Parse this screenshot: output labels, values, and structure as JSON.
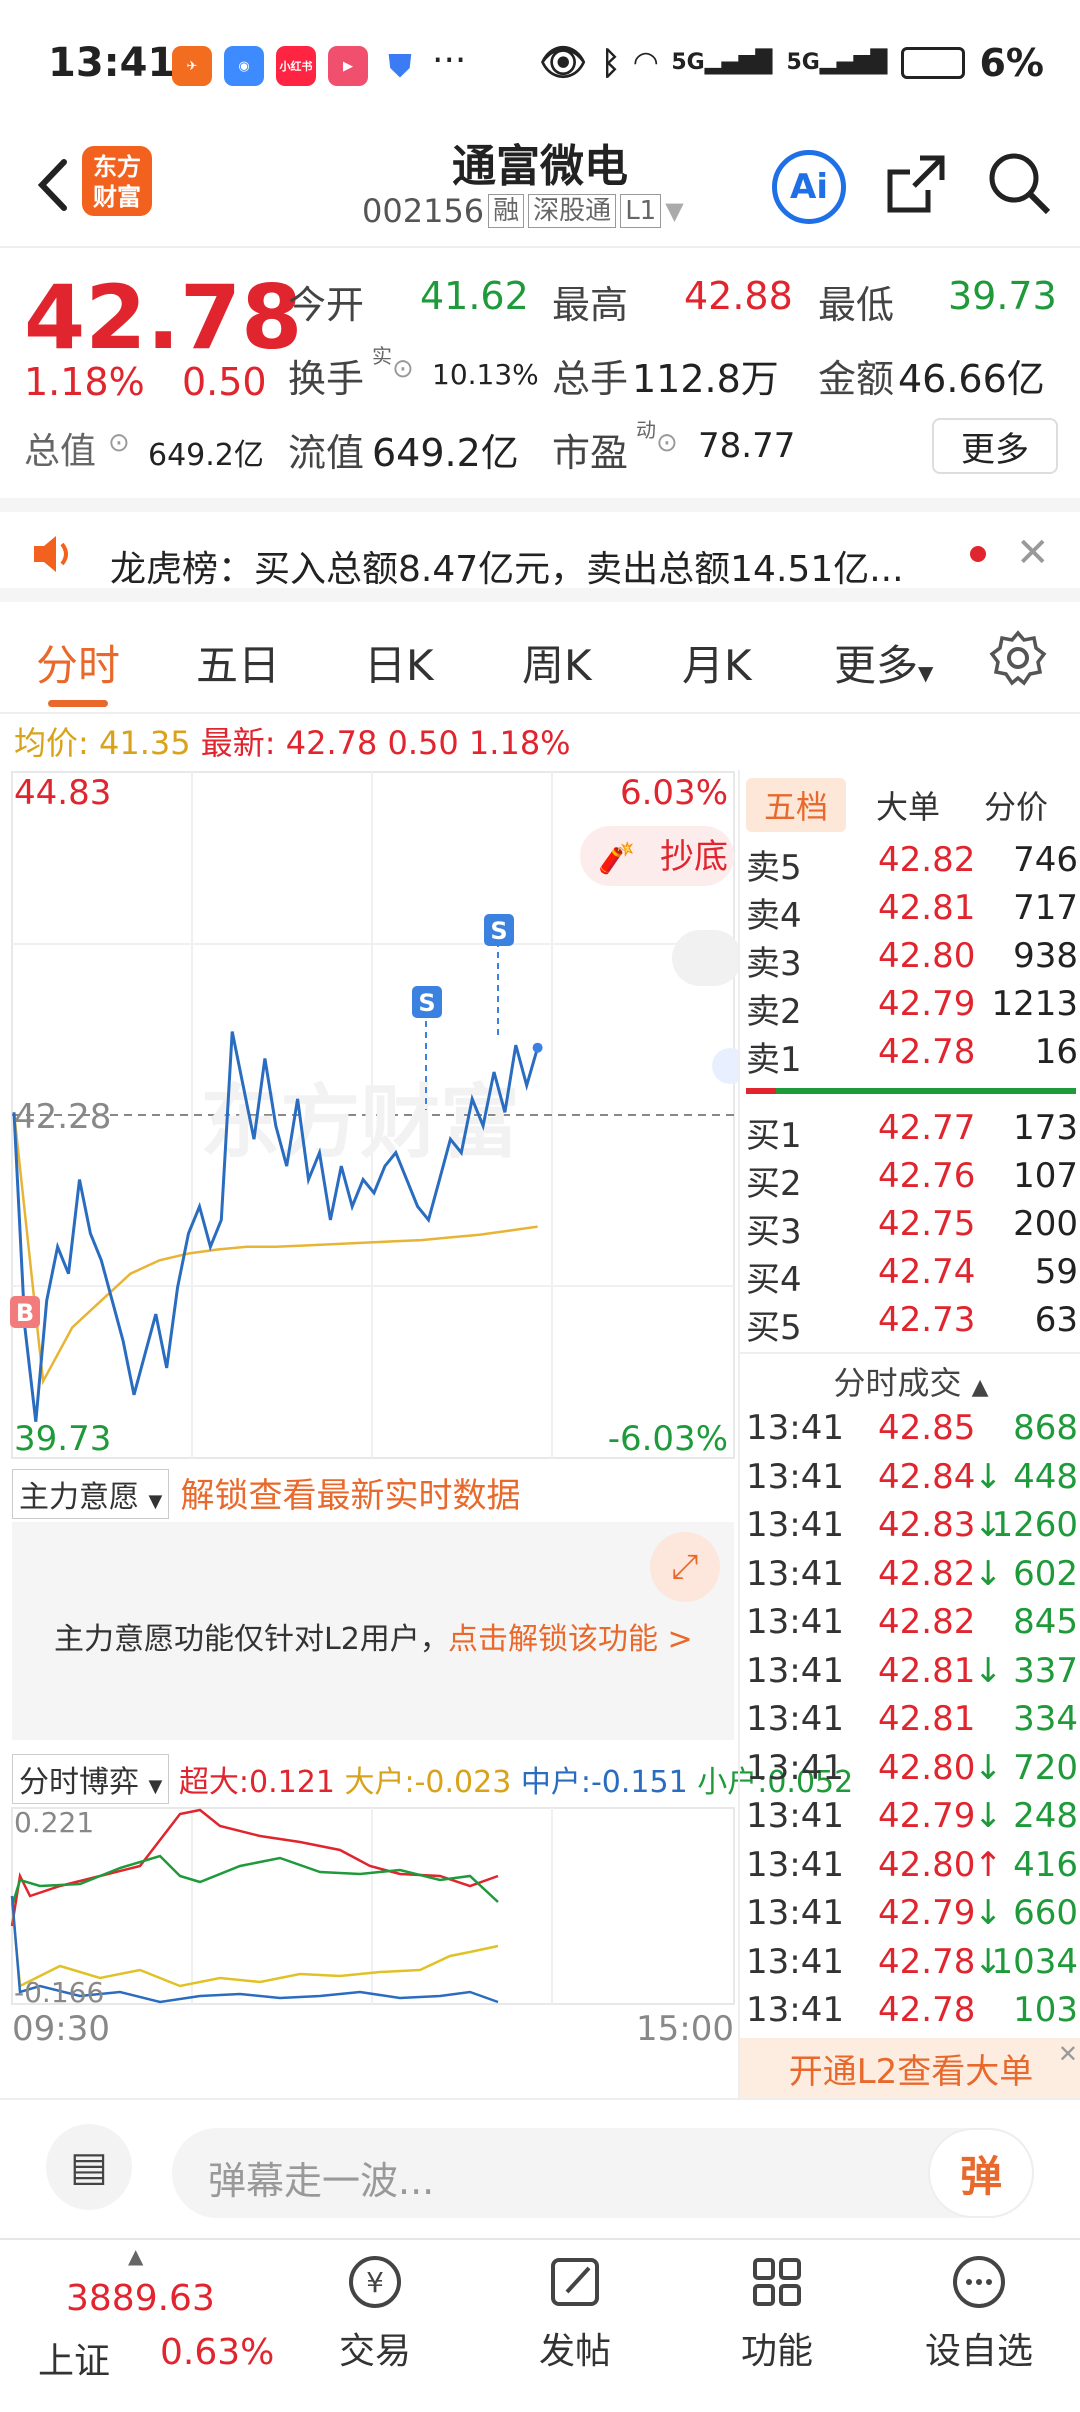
{
  "status_bar": {
    "time": "13:41",
    "battery": "6%",
    "network": "5G",
    "apps": [
      "小红书"
    ]
  },
  "header": {
    "title": "通富微电",
    "code": "002156",
    "tags": [
      "融",
      "深股通",
      "L1"
    ],
    "logo_text": "东方财富",
    "ai_label": "Ai"
  },
  "quote": {
    "price": "42.78",
    "change_pct": "1.18%",
    "change": "0.50",
    "open_label": "今开",
    "open": "41.62",
    "high_label": "最高",
    "high": "42.88",
    "low_label": "最低",
    "low": "39.73",
    "turnover_label": "换手",
    "turnover_sup": "实",
    "turnover": "10.13%",
    "volume_label": "总手",
    "volume": "112.8万",
    "amount_label": "金额",
    "amount": "46.66亿",
    "mktcap_label": "总值",
    "mktcap": "649.2亿",
    "float_label": "流值",
    "float": "649.2亿",
    "pe_label": "市盈",
    "pe_sup": "动",
    "pe": "78.77",
    "more_label": "更多"
  },
  "banner": {
    "text": "龙虎榜：买入总额8.47亿元，卖出总额14.51亿..."
  },
  "tabs": [
    "分时",
    "五日",
    "日K",
    "周K",
    "月K",
    "更多"
  ],
  "info_line": {
    "avg_label": "均价:",
    "avg": "41.35",
    "latest_label": "最新:",
    "latest": "42.78",
    "chg": "0.50",
    "pct": "1.18%"
  },
  "chart": {
    "y_max": "44.83",
    "y_mid": "42.28",
    "y_min": "39.73",
    "pct_max": "6.03%",
    "pct_min": "-6.03%",
    "watermark": "东方财富",
    "badge": "抄底",
    "b_marker": "B",
    "s_marker": "S"
  },
  "chart_data": {
    "type": "line",
    "title": "",
    "ylim": [
      39.73,
      44.83
    ],
    "series": [
      {
        "values": [
          42.3,
          40.7,
          40.0,
          40.9,
          41.3,
          41.1,
          41.8,
          41.4,
          41.2,
          40.9,
          40.6,
          40.2,
          40.5,
          40.8,
          40.4,
          41.0,
          41.4,
          41.6,
          41.3,
          41.5,
          42.9,
          42.5,
          42.1,
          42.7,
          42.2,
          41.9,
          42.4,
          41.8,
          42.0,
          41.5,
          41.9,
          41.6,
          41.8,
          41.7,
          41.9,
          42.0,
          41.8,
          41.6,
          41.5,
          41.8,
          42.1,
          42.0,
          42.4,
          42.2,
          42.6,
          42.3,
          42.8,
          42.5,
          42.78
        ]
      },
      {
        "values": [
          42.3,
          40.3,
          40.7,
          40.9,
          41.1,
          41.2,
          41.25,
          41.28,
          41.3,
          41.3,
          41.31,
          41.32,
          41.33,
          41.34,
          41.35,
          41.37,
          41.39,
          41.42,
          41.45
        ]
      }
    ]
  },
  "lower_panels": {
    "panel1_label": "主力意愿",
    "panel1_unlock": "解锁查看最新实时数据",
    "panel1_text": "主力意愿功能仅针对L2用户，",
    "panel1_link": "点击解锁该功能 >",
    "panel2_label": "分时博弈",
    "super_label": "超大:",
    "super": "0.121",
    "large_label": "大户:",
    "large": "-0.023",
    "mid_label": "中户:",
    "mid": "-0.151",
    "small_label": "小户:",
    "small": "0.052",
    "y_top": "0.221",
    "y_bottom": "-0.166",
    "time_start": "09:30",
    "time_end": "15:00"
  },
  "order_book": {
    "tabs": [
      "五档",
      "大单",
      "分价"
    ],
    "asks": [
      {
        "label": "卖5",
        "price": "42.82",
        "vol": "746"
      },
      {
        "label": "卖4",
        "price": "42.81",
        "vol": "717"
      },
      {
        "label": "卖3",
        "price": "42.80",
        "vol": "938"
      },
      {
        "label": "卖2",
        "price": "42.79",
        "vol": "1213"
      },
      {
        "label": "卖1",
        "price": "42.78",
        "vol": "16"
      }
    ],
    "bids": [
      {
        "label": "买1",
        "price": "42.77",
        "vol": "173"
      },
      {
        "label": "买2",
        "price": "42.76",
        "vol": "107"
      },
      {
        "label": "买3",
        "price": "42.75",
        "vol": "200"
      },
      {
        "label": "买4",
        "price": "42.74",
        "vol": "59"
      },
      {
        "label": "买5",
        "price": "42.73",
        "vol": "63"
      }
    ],
    "trades_title": "分时成交",
    "trades": [
      {
        "time": "13:41",
        "price": "42.85",
        "arrow": "",
        "vol": "868"
      },
      {
        "time": "13:41",
        "price": "42.84",
        "arrow": "↓",
        "vol": "448"
      },
      {
        "time": "13:41",
        "price": "42.83",
        "arrow": "↓",
        "vol": "1260"
      },
      {
        "time": "13:41",
        "price": "42.82",
        "arrow": "↓",
        "vol": "602"
      },
      {
        "time": "13:41",
        "price": "42.82",
        "arrow": "",
        "vol": "845"
      },
      {
        "time": "13:41",
        "price": "42.81",
        "arrow": "↓",
        "vol": "337"
      },
      {
        "time": "13:41",
        "price": "42.81",
        "arrow": "",
        "vol": "334"
      },
      {
        "time": "13:41",
        "price": "42.80",
        "arrow": "↓",
        "vol": "720"
      },
      {
        "time": "13:41",
        "price": "42.79",
        "arrow": "↓",
        "vol": "248"
      },
      {
        "time": "13:41",
        "price": "42.80",
        "arrow": "↑",
        "vol": "416"
      },
      {
        "time": "13:41",
        "price": "42.79",
        "arrow": "↓",
        "vol": "660"
      },
      {
        "time": "13:41",
        "price": "42.78",
        "arrow": "↓",
        "vol": "1034"
      },
      {
        "time": "13:41",
        "price": "42.78",
        "arrow": "",
        "vol": "103"
      }
    ],
    "l2_banner": "开通L2查看大单"
  },
  "barrage": {
    "placeholder": "弹幕走一波...",
    "button": "弹"
  },
  "bottom_nav": {
    "index_value": "3889.63",
    "index_name": "上证",
    "index_pct": "0.63%",
    "items": [
      "交易",
      "发帖",
      "功能",
      "设自选"
    ]
  }
}
